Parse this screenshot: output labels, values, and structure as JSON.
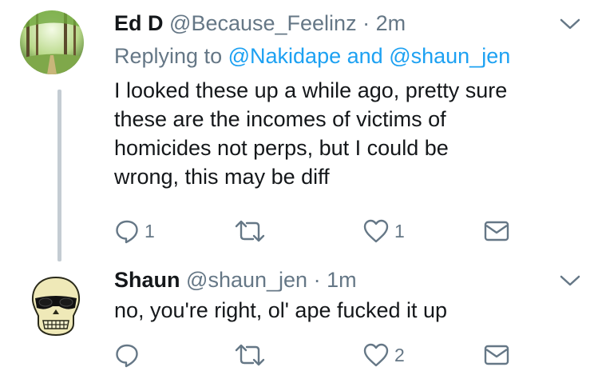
{
  "tweets": [
    {
      "name": "Ed D",
      "handle": "@Because_Feelinz",
      "separator": "·",
      "time": "2m",
      "replying_prefix": "Replying to",
      "replying_mention_1": "@Nakidape",
      "replying_and": "and",
      "replying_mention_2": "@shaun_jen",
      "text_lines": [
        "I looked these up a while ago, pretty sure",
        "these are the incomes of victims of",
        "homicides not perps, but I could be",
        "wrong, this may be diff"
      ],
      "reply_count": "1",
      "retweet_count": "",
      "like_count": "1",
      "avatar_icon": "forest-photo"
    },
    {
      "name": "Shaun",
      "handle": "@shaun_jen",
      "separator": "·",
      "time": "1m",
      "text_lines": [
        "no, you're right, ol' ape fucked it up"
      ],
      "reply_count": "",
      "retweet_count": "",
      "like_count": "2",
      "avatar_icon": "skull-sunglasses"
    }
  ],
  "colors": {
    "icon_gray": "#657786",
    "link_blue": "#1da1f2",
    "text_dark": "#14171a",
    "thread_line": "#c4ccd3"
  }
}
